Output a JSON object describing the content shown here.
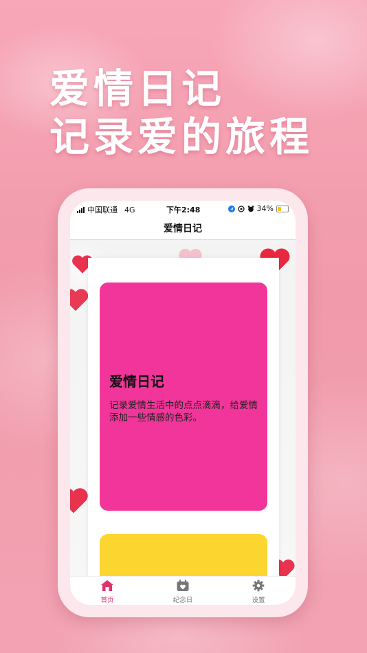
{
  "headline": {
    "line1": "爱情日记",
    "line2": "记录爱的旅程"
  },
  "status_bar": {
    "carrier": "中国联通",
    "network": "4G",
    "time": "下午2:48",
    "battery": "34%"
  },
  "app": {
    "nav_title": "爱情日记",
    "card": {
      "title": "爱情日记",
      "description": "记录爱情生活中的点点滴滴，给爱情添加一些情感的色彩。"
    },
    "tabs": [
      {
        "label": "首页",
        "icon": "home-icon",
        "active": true
      },
      {
        "label": "纪念日",
        "icon": "calendar-heart-icon",
        "active": false
      },
      {
        "label": "设置",
        "icon": "gear-icon",
        "active": false
      }
    ]
  },
  "colors": {
    "background": "#f19aab",
    "card_pink": "#f2359a",
    "card_yellow": "#fdd52f",
    "tab_active": "#e0336d"
  }
}
